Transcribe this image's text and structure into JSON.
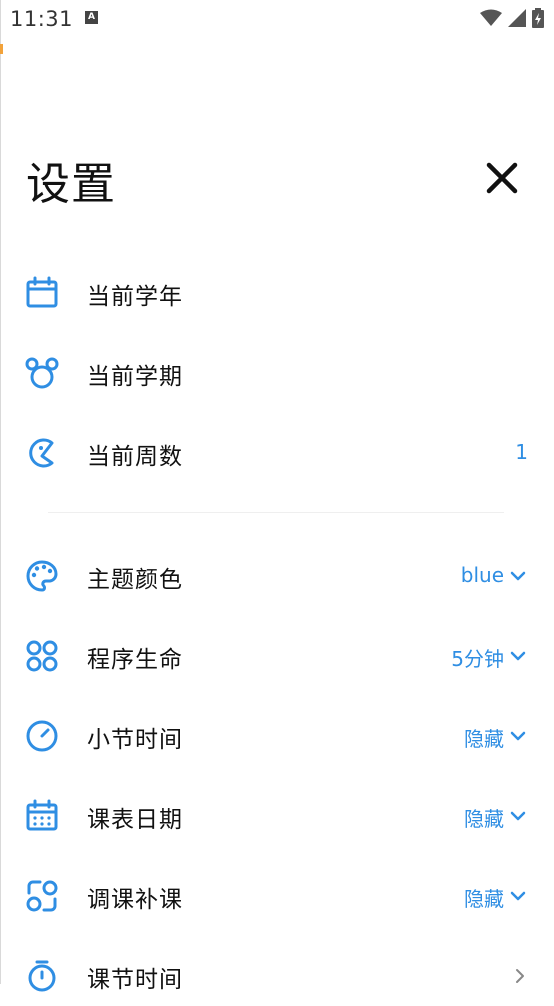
{
  "status_bar": {
    "time": "11:31",
    "notification_badge": "A"
  },
  "header": {
    "title": "设置"
  },
  "colors": {
    "accent": "#2f8ee3",
    "text": "#111111"
  },
  "settings": [
    {
      "icon": "calendar-icon",
      "label": "当前学年",
      "value": ""
    },
    {
      "icon": "semester-icon",
      "label": "当前学期",
      "value": ""
    },
    {
      "icon": "pie-icon",
      "label": "当前周数",
      "value": "1"
    },
    {
      "icon": "palette-icon",
      "label": "主题颜色",
      "value": "blue",
      "dropdown": true
    },
    {
      "icon": "apps-icon",
      "label": "程序生命",
      "value": "5分钟",
      "dropdown": true
    },
    {
      "icon": "clock-icon",
      "label": "小节时间",
      "value": "隐藏",
      "dropdown": true
    },
    {
      "icon": "calendar-dates-icon",
      "label": "课表日期",
      "value": "隐藏",
      "dropdown": true
    },
    {
      "icon": "swap-icon",
      "label": "调课补课",
      "value": "隐藏",
      "dropdown": true
    },
    {
      "icon": "timer-icon",
      "label": "课节时间",
      "value": "",
      "chevron_right": true
    }
  ]
}
